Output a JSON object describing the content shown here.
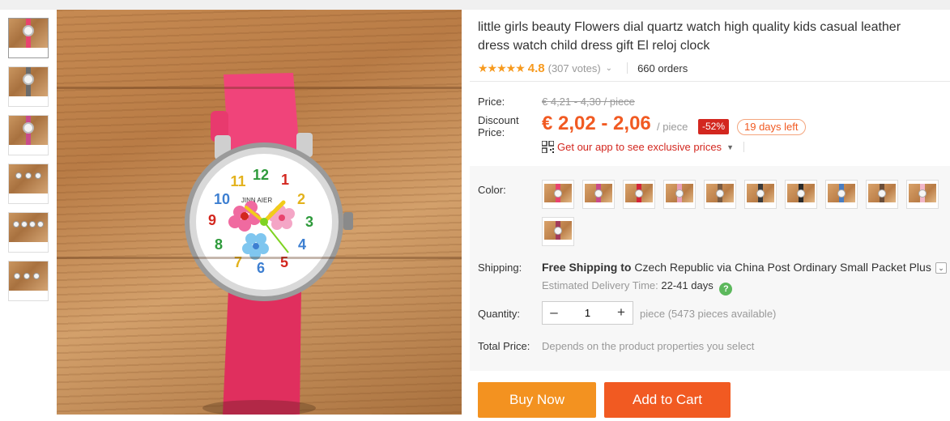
{
  "product": {
    "title": "little girls beauty Flowers dial quartz watch high quality kids casual leather dress watch child dress gift El reloj clock",
    "stars": "★★★★★",
    "rating": "4.8",
    "votes": "(307 votes)",
    "orders": "660 orders"
  },
  "pricing": {
    "price_label": "Price:",
    "old_price": "€ 4,21 - 4,30 / piece",
    "discount_label": "Discount Price:",
    "new_price": "€ 2,02 - 2,06",
    "unit": "/ piece",
    "discount": "-52%",
    "days_left": "19 days left",
    "app_promo": "Get our app to see exclusive prices"
  },
  "options": {
    "color_label": "Color:",
    "swatch_colors": [
      "#e8446e",
      "#c94c8a",
      "#d4263a",
      "#e8a0b8",
      "#7a5c44",
      "#3b3b3b",
      "#2b2b2b",
      "#4a7ec2",
      "#6b4e3a",
      "#f2b6c8",
      "#a23b5a"
    ],
    "shipping_label": "Shipping:",
    "shipping_free": "Free Shipping to",
    "shipping_rest": "Czech Republic via China Post Ordinary Small Packet Plus",
    "delivery_label": "Estimated Delivery Time:",
    "delivery_days": "22-41 days",
    "quantity_label": "Quantity:",
    "quantity_value": "1",
    "quantity_info": "piece (5473 pieces available)",
    "total_label": "Total Price:",
    "total_info": "Depends on the product properties you select"
  },
  "actions": {
    "buy_now": "Buy Now",
    "add_to_cart": "Add to Cart"
  },
  "thumbnails": [
    "watch-front",
    "watch-silver",
    "watch-strap",
    "watch-multiple",
    "watch-set",
    "watch-collection"
  ]
}
